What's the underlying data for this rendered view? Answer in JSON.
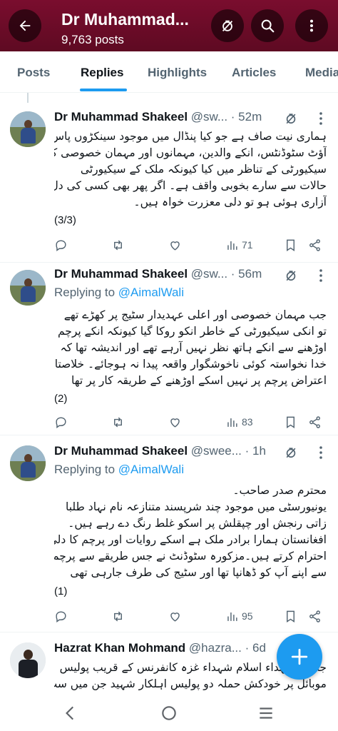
{
  "header": {
    "title": "Dr Muhammad...",
    "subtitle": "9,763 posts",
    "icons": [
      "back-arrow-icon",
      "mute-icon",
      "search-icon",
      "more-vertical-icon"
    ]
  },
  "tabs": [
    {
      "label": "Posts"
    },
    {
      "label": "Replies"
    },
    {
      "label": "Highlights"
    },
    {
      "label": "Articles"
    },
    {
      "label": "Media"
    }
  ],
  "active_tab": "Replies",
  "tweets": [
    {
      "name": "Dr Muhammad Shakeel",
      "handle": "@sw...",
      "time": "· 52m",
      "replying_to": "",
      "lines": [
        "ہماری نیت صاف ہے جو کیا پنڈال میں موجود سینکڑوں پاس",
        "آؤٹ سٹوڈنٹس، انکے والدین، مہمانوں اور مہمان خصوصی کے",
        "سیکیورٹی کے تناظر میں کیا کیونکہ ملک کے سیکیورٹی",
        "حالات سے سارے بخوبی واقف ہے۔ اگر پھر بھی کسی کی دل",
        "آزاری ہوئی ہو تو دلی معزرت خواہ ہیں۔"
      ],
      "counter": "(3/3)",
      "views": "71"
    },
    {
      "name": "Dr Muhammad Shakeel",
      "handle": "@sw...",
      "time": "· 56m",
      "replying_prefix": "Replying to",
      "replying_to": "@AimalWali",
      "lines": [
        "جب مہمان خصوصی اور اعلی عہدیدار سٹیج پر کھڑے تھے",
        "تو انکی سیکیورٹی کے خاطر انکو روکا گیا کیونکہ انکے پرچم",
        "اوڑھنے سے انکے ہاتھ نظر نہیں آرہے تھے اور اندیشہ تھا کہ",
        "خدا نخواستہ کوئی ناخوشگوار واقعہ پیدا نہ ہوجائے۔ خلاصتا",
        "اعتراض پرچم پر نہیں اسکے اوڑھنے کے طریقہ کار پر تھا"
      ],
      "counter": "(2)",
      "views": "83"
    },
    {
      "name": "Dr Muhammad Shakeel",
      "handle": "@swee...",
      "time": "· 1h",
      "replying_prefix": "Replying to",
      "replying_to": "@AimalWali",
      "lines": [
        "محترم صدر صاحب۔",
        "یونیورسٹی میں موجود چند شرپسند متنازعہ نام نہاد طلبا",
        "زاتی رنجش اور چپقلش پر اسکو غلط رنگ دے رہے ہیں۔",
        "افغانستان ہمارا برادر ملک ہے اسکے روایات اور پرچم کا دلی",
        "احترام کرتے ہیں۔مزکورہ سٹوڈنٹ نے جس طریقے سے پرچم",
        "سے اپنے آپ کو ڈھانپا تھا اور سٹیج کی طرف جارہی تھی"
      ],
      "counter": "(1)",
      "views": "95"
    },
    {
      "name": "Hazrat Khan Mohmand",
      "handle": "@hazra...",
      "time": "· 6d",
      "replying_to": "",
      "lines": [
        "جامعہ شہداء اسلام شہداء غزہ کانفرنس کے قریب پولیس",
        "موبائل پر خودکش حملہ دو پولیس اہلکار شہید جن میں سب"
      ],
      "counter": "",
      "views": ""
    }
  ],
  "fab": {
    "icon": "plus-icon",
    "label": "+"
  },
  "navbar": {
    "icons": [
      "nav-back-icon",
      "nav-home-icon",
      "nav-recents-icon"
    ]
  }
}
